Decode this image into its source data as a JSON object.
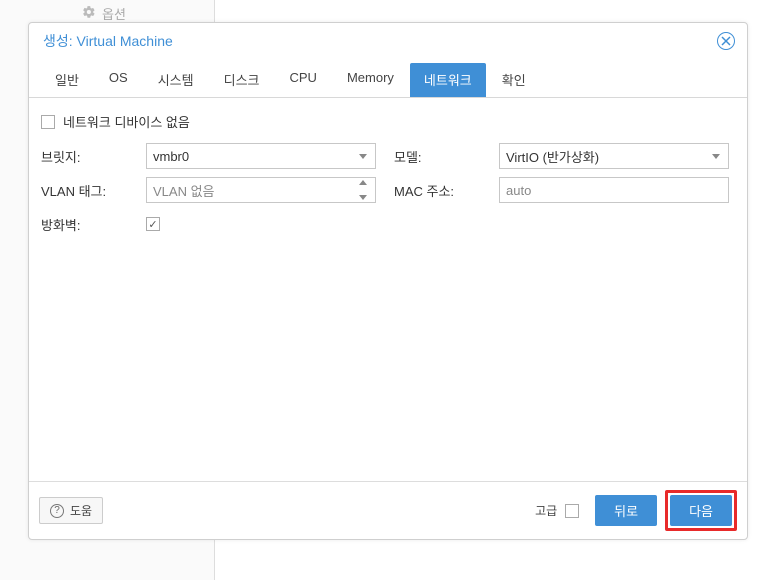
{
  "background": {
    "option_label": "옵션"
  },
  "dialog": {
    "title": "생성: Virtual Machine"
  },
  "tabs": [
    {
      "label": "일반",
      "active": false
    },
    {
      "label": "OS",
      "active": false
    },
    {
      "label": "시스템",
      "active": false
    },
    {
      "label": "디스크",
      "active": false
    },
    {
      "label": "CPU",
      "active": false
    },
    {
      "label": "Memory",
      "active": false
    },
    {
      "label": "네트워크",
      "active": true
    },
    {
      "label": "확인",
      "active": false
    }
  ],
  "panel": {
    "no_network_label": "네트워크 디바이스 없음",
    "no_network_checked": false,
    "bridge_label": "브릿지:",
    "bridge_value": "vmbr0",
    "vlan_label": "VLAN 태그:",
    "vlan_value": "VLAN 없음",
    "firewall_label": "방화벽:",
    "firewall_checked": true,
    "model_label": "모델:",
    "model_value": "VirtIO (반가상화)",
    "mac_label": "MAC 주소:",
    "mac_placeholder": "auto"
  },
  "footer": {
    "help_label": "도움",
    "advanced_label": "고급",
    "advanced_checked": false,
    "back_label": "뒤로",
    "next_label": "다음"
  }
}
